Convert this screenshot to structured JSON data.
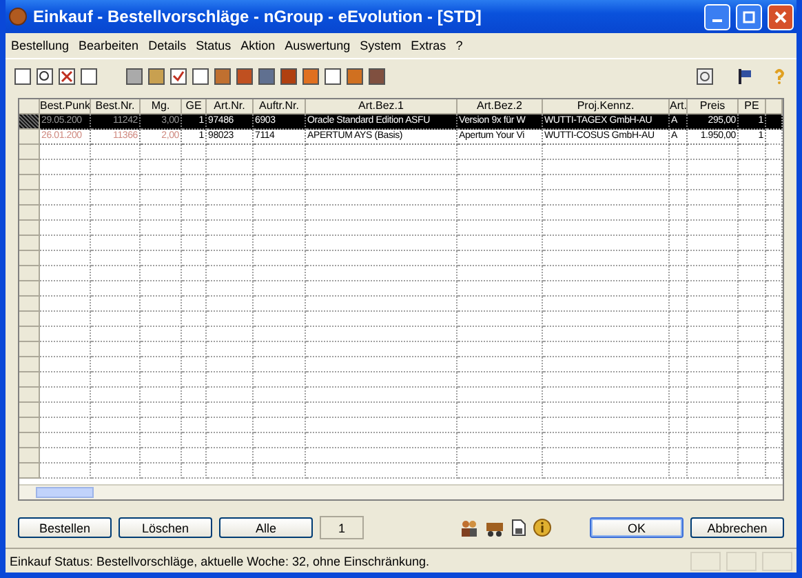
{
  "window": {
    "title": "Einkauf - Bestellvorschläge - nGroup - eEvolution - [STD]"
  },
  "menu": [
    "Bestellung",
    "Bearbeiten",
    "Details",
    "Status",
    "Aktion",
    "Auswertung",
    "System",
    "Extras",
    "?"
  ],
  "table": {
    "columns": [
      "Best.Punk",
      "Best.Nr.",
      "Mg.",
      "GE",
      "Art.Nr.",
      "Auftr.Nr.",
      "Art.Bez.1",
      "Art.Bez.2",
      "Proj.Kennz.",
      "Art.",
      "Preis",
      "PE"
    ],
    "rows": [
      {
        "selected": true,
        "marked": true,
        "cells": [
          "29.05.200",
          "11242",
          "3,00",
          "1",
          "97486",
          "6903",
          "Oracle Standard Edition ASFU",
          "Version 9x für W",
          "WUTTI-TAGEX GmbH-AU",
          "A",
          "295,00",
          "1"
        ]
      },
      {
        "selected": false,
        "marked": true,
        "cells": [
          "26.01.200",
          "11366",
          "2,00",
          "1",
          "98023",
          "7114",
          "APERTUM AYS (Basis)",
          "Apertum Your Vi",
          "WUTTI-COSUS GmbH-AU",
          "A",
          "1.950,00",
          "1"
        ]
      }
    ]
  },
  "buttons": [
    "Bestellen",
    "Löschen",
    "Alle"
  ],
  "counter": "1",
  "dialog_buttons": [
    {
      "label": "OK",
      "default": true
    },
    {
      "label": "Abbrechen",
      "default": false
    }
  ],
  "status_bar": "Einkauf Status: Bestellvorschläge, aktuelle Woche: 32, ohne Einschränkung."
}
